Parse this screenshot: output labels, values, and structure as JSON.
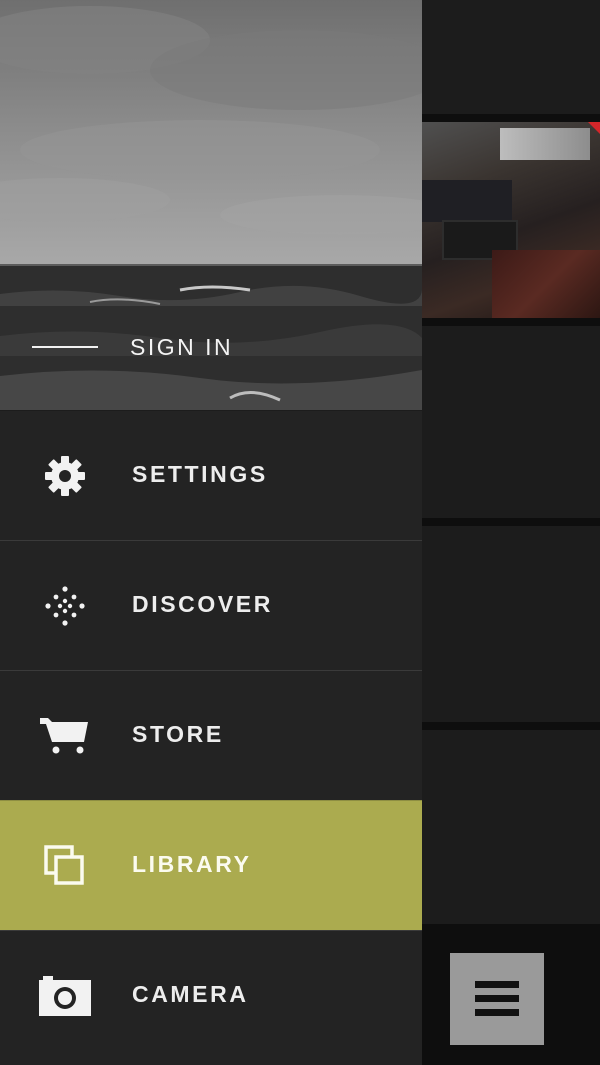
{
  "drawer": {
    "sign_in": "SIGN IN",
    "items": [
      {
        "label": "SETTINGS",
        "icon": "gear-icon",
        "active": false
      },
      {
        "label": "DISCOVER",
        "icon": "dots-circle-icon",
        "active": false
      },
      {
        "label": "STORE",
        "icon": "cart-icon",
        "active": false
      },
      {
        "label": "LIBRARY",
        "icon": "stacked-squares-icon",
        "active": true
      },
      {
        "label": "CAMERA",
        "icon": "camera-icon",
        "active": false
      }
    ]
  },
  "menu_button": {
    "icon": "hamburger-icon"
  },
  "colors": {
    "accent": "#abab4f",
    "drawer_bg": "#232323",
    "menu_button_bg": "#9a9a9a"
  }
}
